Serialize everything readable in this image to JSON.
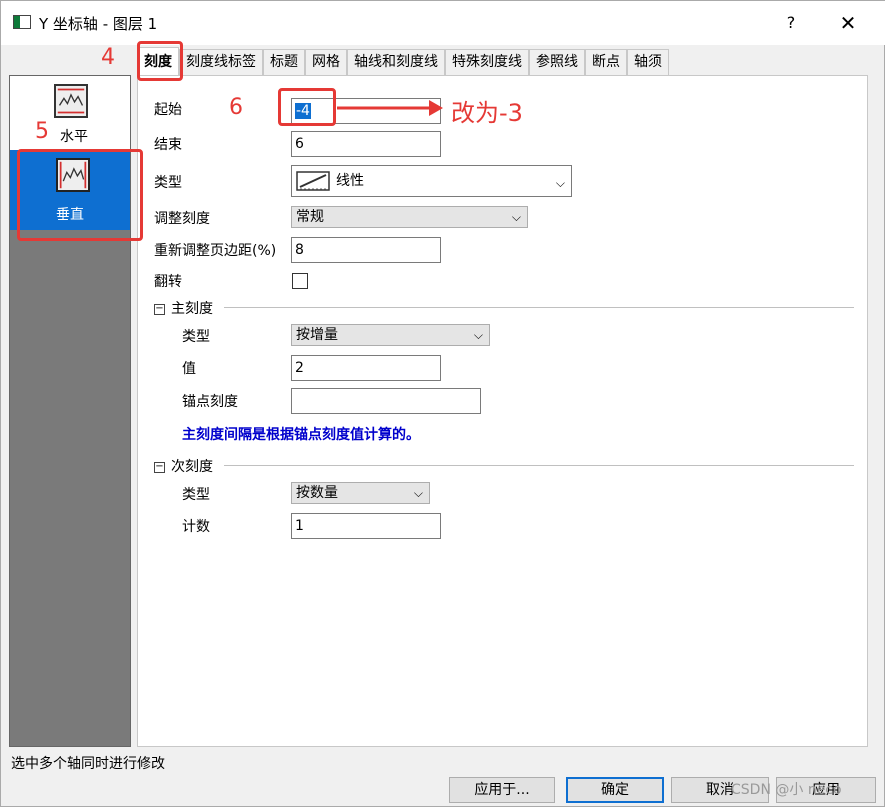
{
  "window": {
    "title": "Y 坐标轴 - 图层 1",
    "help_label": "?",
    "close_label": "✕"
  },
  "tabs": [
    {
      "label": "刻度",
      "active": true
    },
    {
      "label": "刻度线标签"
    },
    {
      "label": "标题"
    },
    {
      "label": "网格"
    },
    {
      "label": "轴线和刻度线"
    },
    {
      "label": "特殊刻度线"
    },
    {
      "label": "参照线"
    },
    {
      "label": "断点"
    },
    {
      "label": "轴须"
    }
  ],
  "axis_list": {
    "horizontal_label": "水平",
    "vertical_label": "垂直",
    "selected": "垂直"
  },
  "form": {
    "start_label": "起始",
    "start_value": "-4",
    "end_label": "结束",
    "end_value": "6",
    "type_label": "类型",
    "type_value": "线性",
    "rescale_label": "调整刻度",
    "rescale_value": "常规",
    "margin_label": "重新调整页边距(%)",
    "margin_value": "8",
    "reverse_label": "翻转"
  },
  "major": {
    "section_label": "主刻度",
    "collapse_glyph": "−",
    "type_label": "类型",
    "type_value": "按增量",
    "value_label": "值",
    "value_value": "2",
    "anchor_label": "锚点刻度",
    "anchor_value": "",
    "info": "主刻度间隔是根据锚点刻度值计算的。"
  },
  "minor": {
    "section_label": "次刻度",
    "collapse_glyph": "−",
    "type_label": "类型",
    "type_value": "按数量",
    "count_label": "计数",
    "count_value": "1"
  },
  "status_text": "选中多个轴同时进行修改",
  "buttons": {
    "apply_to": "应用于...",
    "ok": "确定",
    "cancel": "取消",
    "apply": "应用"
  },
  "annotations": {
    "step4": "4",
    "step5": "5",
    "step6": "6",
    "note": "改为-3",
    "color": "#e53935"
  },
  "watermark": "CSDN @小 neco",
  "colors": {
    "selection": "#0e6fd1",
    "info_text": "#0000cc"
  }
}
